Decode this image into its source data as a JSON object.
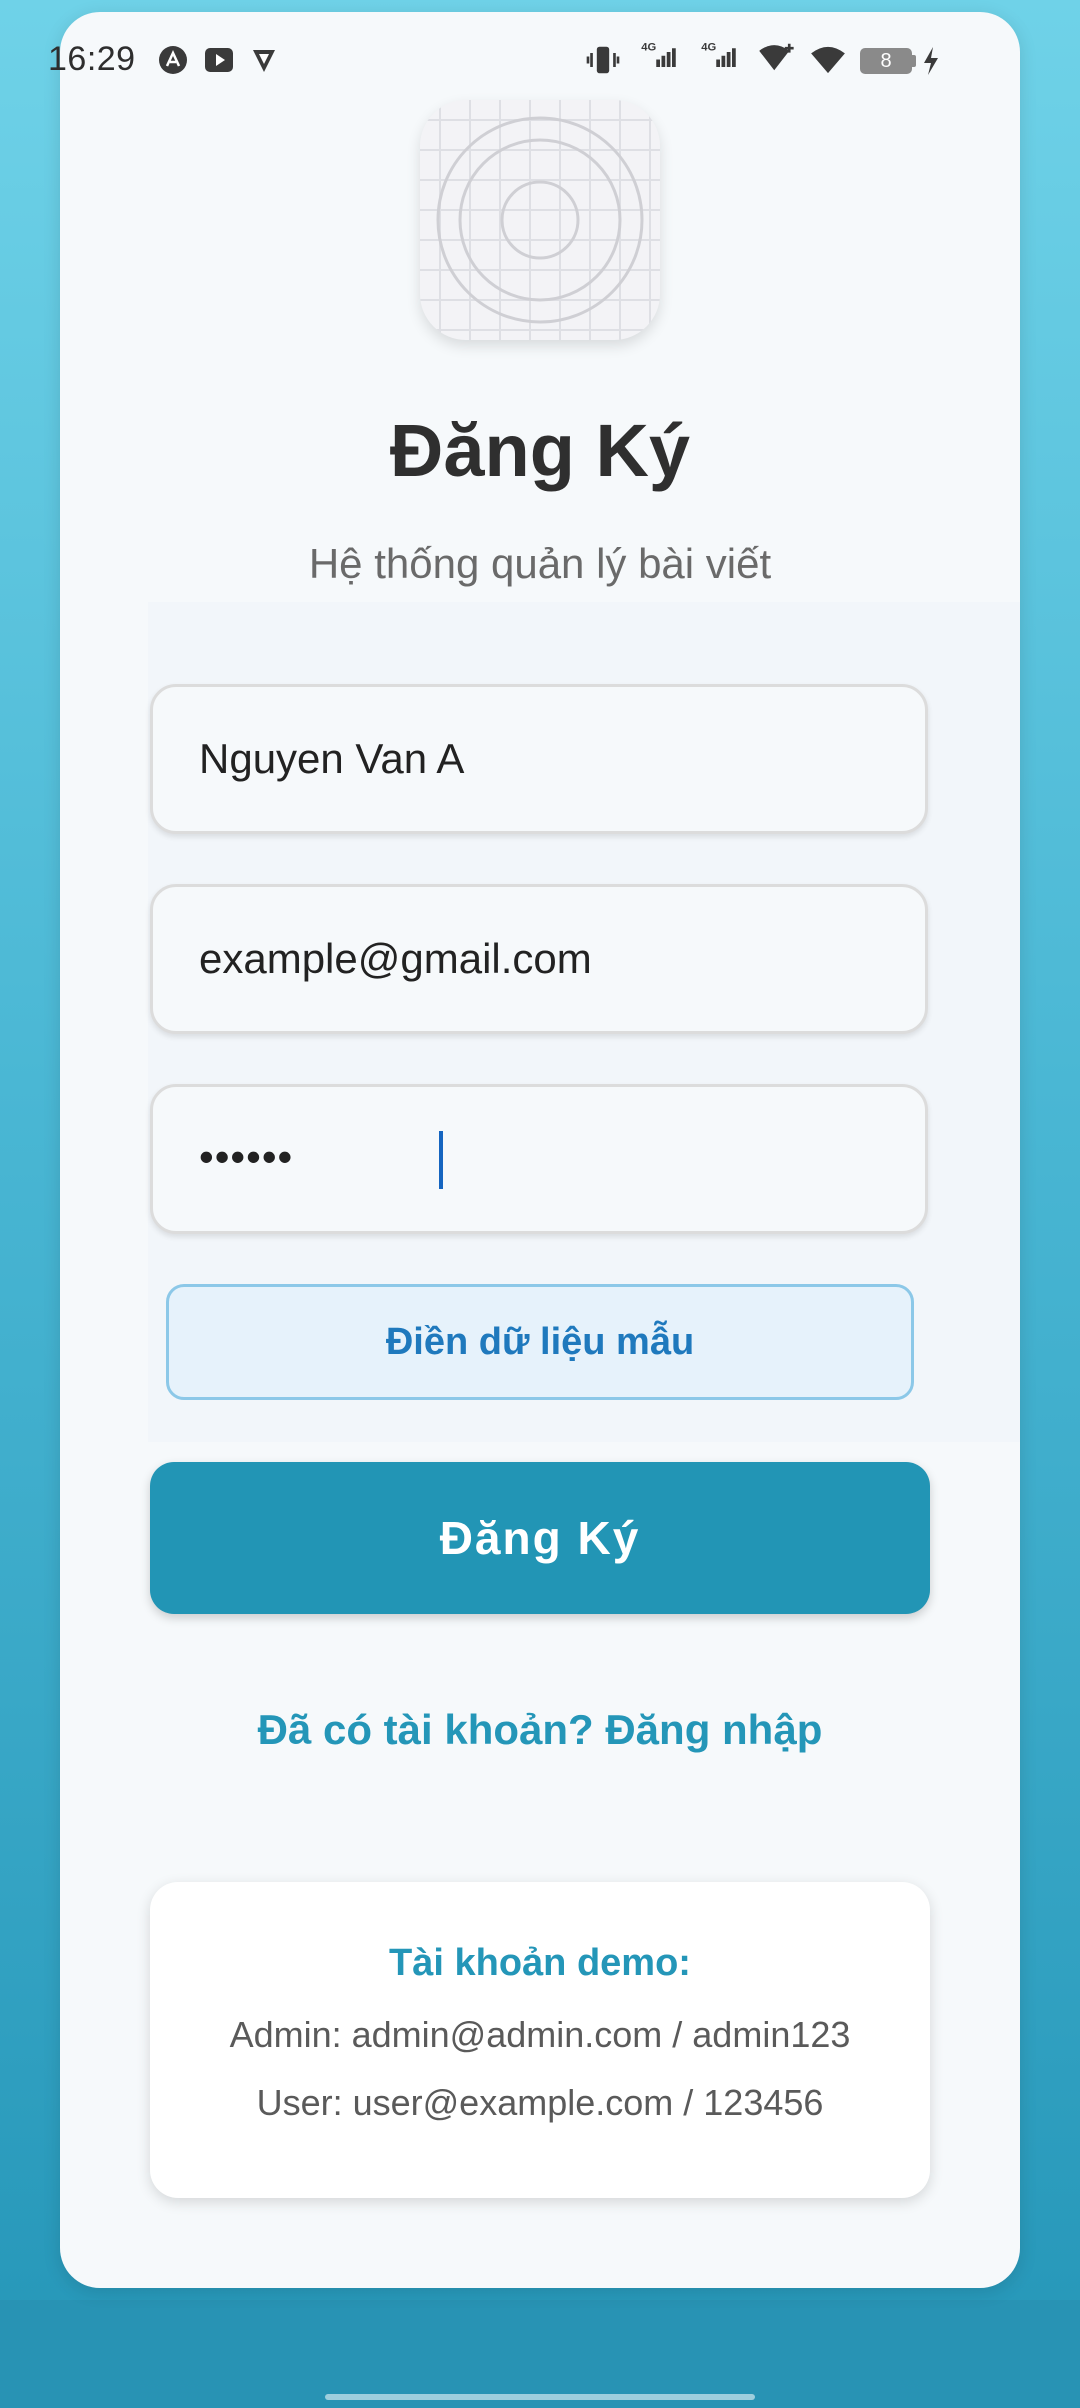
{
  "status_bar": {
    "time": "16:29",
    "battery": "8",
    "network_1": "4G",
    "network_2": "4G"
  },
  "header": {
    "title": "Đăng Ký",
    "subtitle": "Hệ thống quản lý bài viết"
  },
  "form": {
    "name_value": "Nguyen Van A",
    "email_value": "example@gmail.com",
    "password_mask": "••••••",
    "fill_sample_label": "Điền dữ liệu mẫu",
    "submit_label": "Đăng Ký"
  },
  "login_link": "Đã có tài khoản? Đăng nhập",
  "demo": {
    "title": "Tài khoản demo:",
    "admin_line": "Admin: admin@admin.com / admin123",
    "user_line": "User: user@example.com / 123456"
  },
  "colors": {
    "accent": "#2295b5",
    "link": "#2496b8",
    "sample_button_text": "#1f79bd"
  }
}
